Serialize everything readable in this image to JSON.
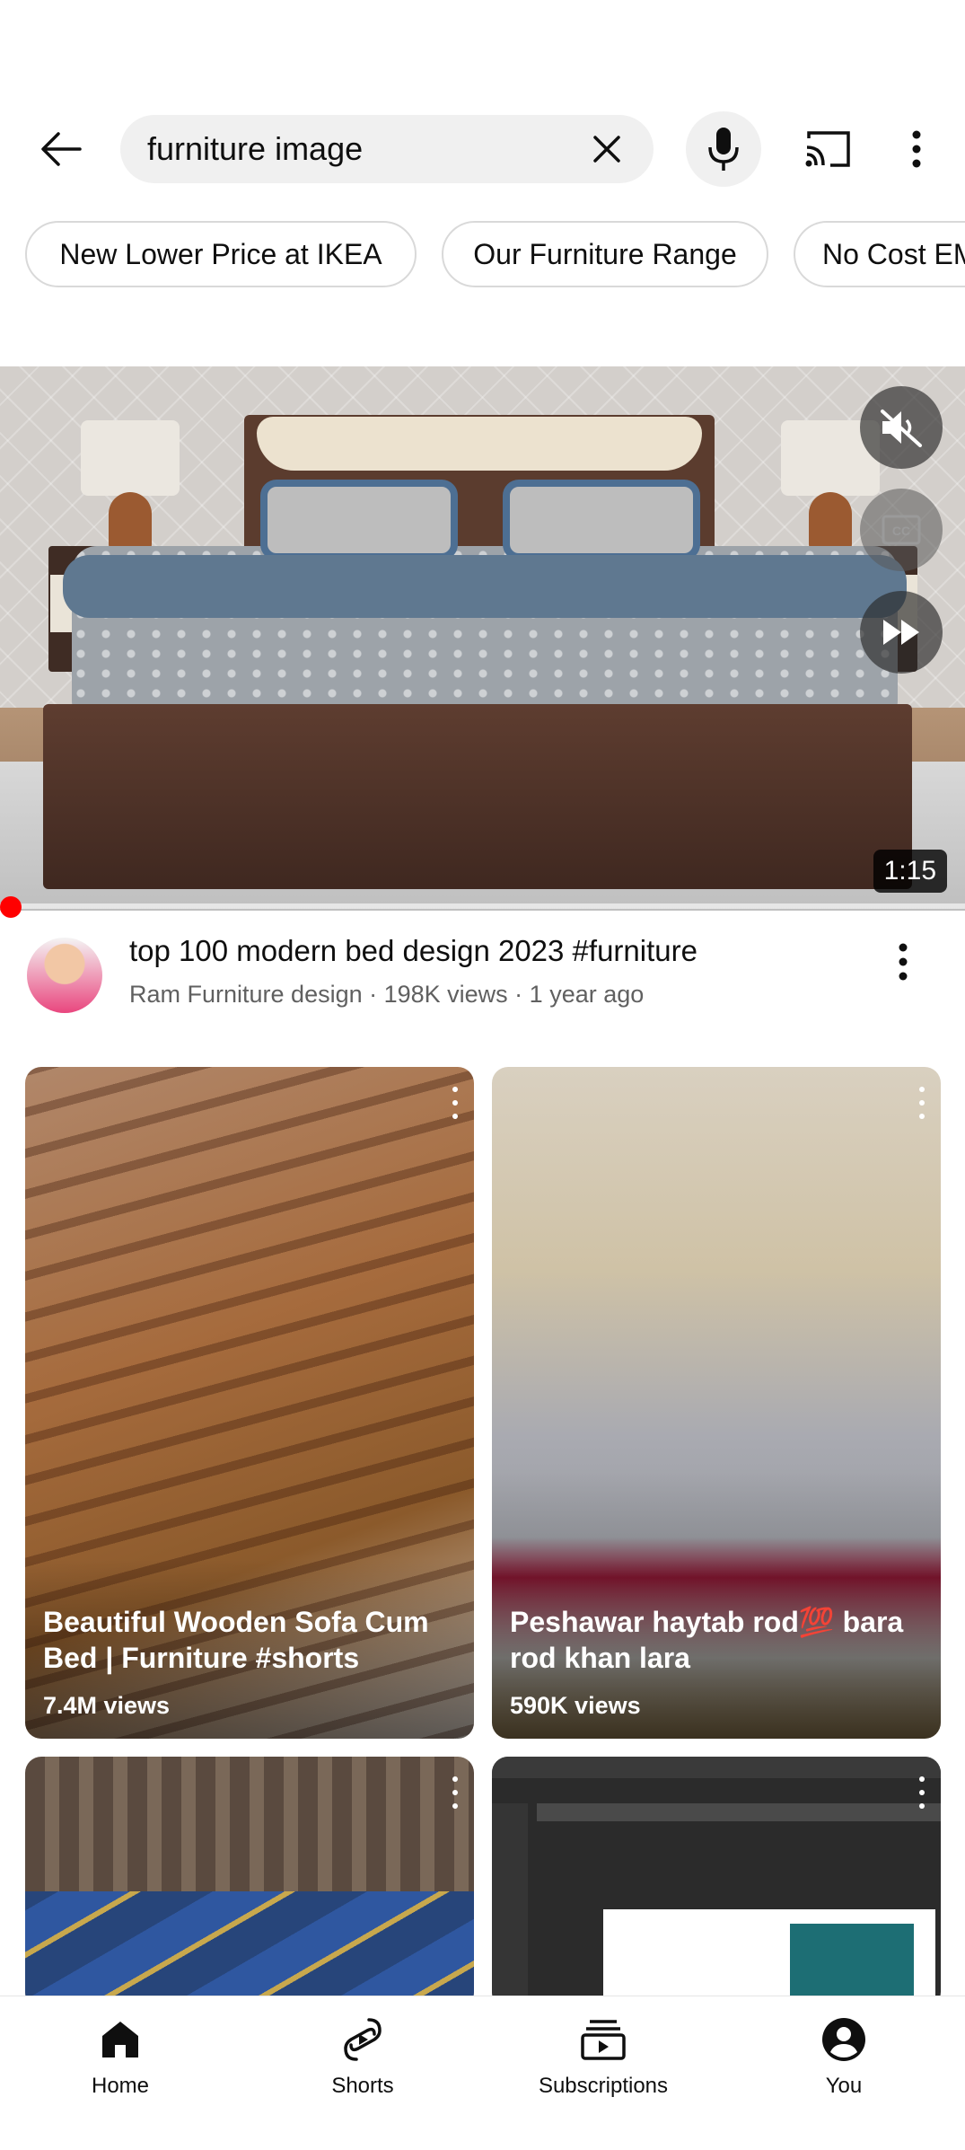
{
  "header": {
    "search_value": "furniture image"
  },
  "chips": [
    {
      "label": "New Lower Price at IKEA"
    },
    {
      "label": "Our Furniture Range"
    },
    {
      "label": "No Cost EMI"
    }
  ],
  "video": {
    "duration": "1:15",
    "title": "top 100 modern bed design 2023 #furniture",
    "meta": "Ram Furniture design · 198K views · 1 year ago",
    "progress": 0.01
  },
  "shorts": [
    {
      "title": "Beautiful Wooden Sofa Cum Bed | Furniture #shorts",
      "views": "7.4M views"
    },
    {
      "title": "Peshawar haytab rod💯 bara rod khan lara",
      "views": "590K views"
    },
    {
      "title": "",
      "views": ""
    },
    {
      "title": "",
      "views": ""
    }
  ],
  "nav": {
    "home": "Home",
    "shorts": "Shorts",
    "subscriptions": "Subscriptions",
    "you": "You"
  },
  "icons": {
    "back": "back-arrow-icon",
    "clear": "close-icon",
    "mic": "microphone-icon",
    "cast": "cast-icon",
    "more": "more-vertical-icon",
    "mute": "volume-off-icon",
    "captions": "captions-icon",
    "skip": "fast-forward-icon"
  },
  "colors": {
    "accent": "#ff0000",
    "text_primary": "#0f0f0f",
    "text_secondary": "#606060",
    "chip_border": "#d9d9d9",
    "search_bg": "#f0f0f0"
  }
}
